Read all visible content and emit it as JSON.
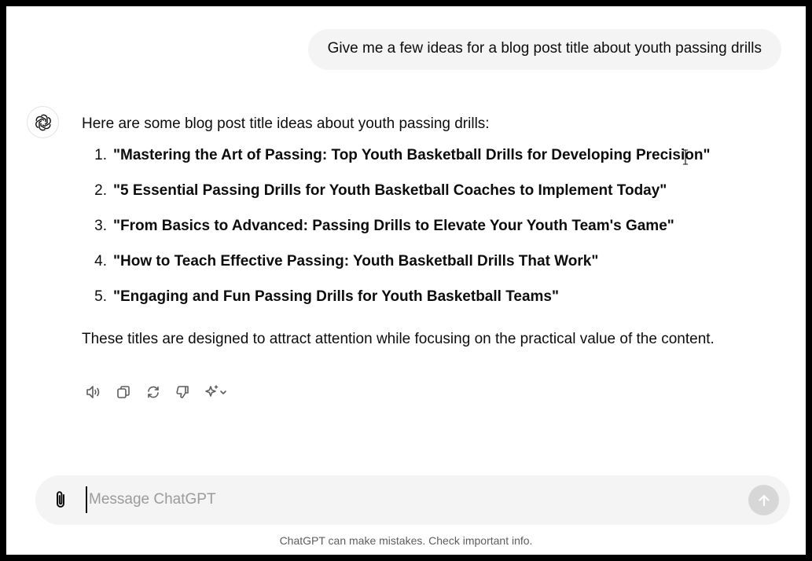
{
  "conversation": {
    "user_message": "Give me a few ideas for a blog post title about youth passing drills",
    "assistant": {
      "intro": "Here are some blog post title ideas about youth passing drills:",
      "titles": [
        {
          "num": "1.",
          "text": "\"Mastering the Art of Passing: Top Youth Basketball Drills for Developing Precision\""
        },
        {
          "num": "2.",
          "text": "\"5 Essential Passing Drills for Youth Basketball Coaches to Implement Today\""
        },
        {
          "num": "3.",
          "text": "\"From Basics to Advanced: Passing Drills to Elevate Your Youth Team's Game\""
        },
        {
          "num": "4.",
          "text": "\"How to Teach Effective Passing: Youth Basketball Drills That Work\""
        },
        {
          "num": "5.",
          "text": "\"Engaging and Fun Passing Drills for Youth Basketball Teams\""
        }
      ],
      "outro": "These titles are designed to attract attention while focusing on the practical value of the content."
    },
    "action_icons": [
      "read-aloud-icon",
      "copy-icon",
      "regenerate-icon",
      "thumbs-down-icon",
      "model-switch-icon"
    ]
  },
  "composer": {
    "placeholder": "Message ChatGPT",
    "value": ""
  },
  "footer": {
    "disclaimer": "ChatGPT can make mistakes. Check important info."
  },
  "colors": {
    "bubble_bg": "#f4f4f4",
    "text": "#0d0d0d",
    "send_disabled": "#d7d7d7"
  }
}
